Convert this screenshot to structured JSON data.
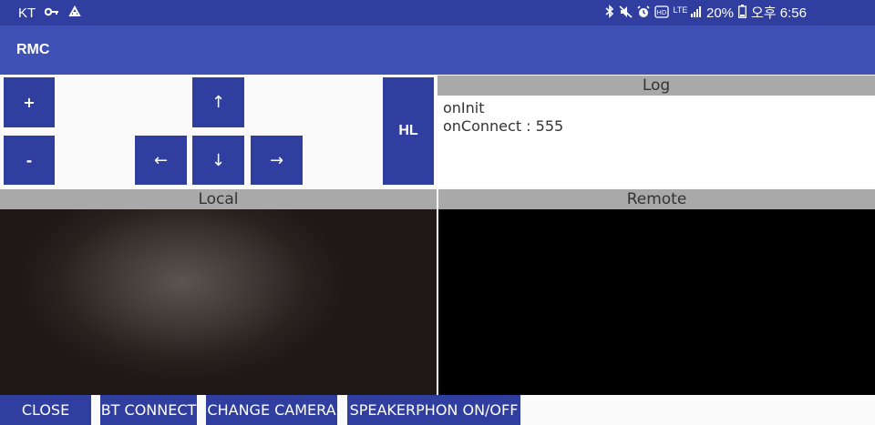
{
  "status_bar": {
    "carrier": "KT",
    "left_icons": [
      "key-icon",
      "notification-icon"
    ],
    "right_icons": [
      "bluetooth-icon",
      "mute-icon",
      "alarm-icon",
      "hd-icon"
    ],
    "network": "LTE",
    "battery_percent": "20%",
    "time": "오후 6:56"
  },
  "app_bar": {
    "title": "RMC"
  },
  "controls": {
    "plus": "+",
    "minus": "-",
    "up": "↑",
    "left": "←",
    "down": "↓",
    "right": "→",
    "hl": "HL"
  },
  "log": {
    "header": "Log",
    "lines": [
      "onInit",
      "onConnect : 555"
    ]
  },
  "local": {
    "header": "Local"
  },
  "remote": {
    "header": "Remote"
  },
  "bottom_buttons": {
    "close": "CLOSE",
    "bt_connect": "BT CONNECT",
    "change_camera": "CHANGE CAMERA",
    "speakerphone": "SPEAKERPHON ON/OFF"
  },
  "colors": {
    "status_bar": "#303f9f",
    "app_bar": "#3f51b5",
    "button": "#303f9f",
    "panel_header": "#a9a9a9",
    "remote_video": "#000000"
  }
}
